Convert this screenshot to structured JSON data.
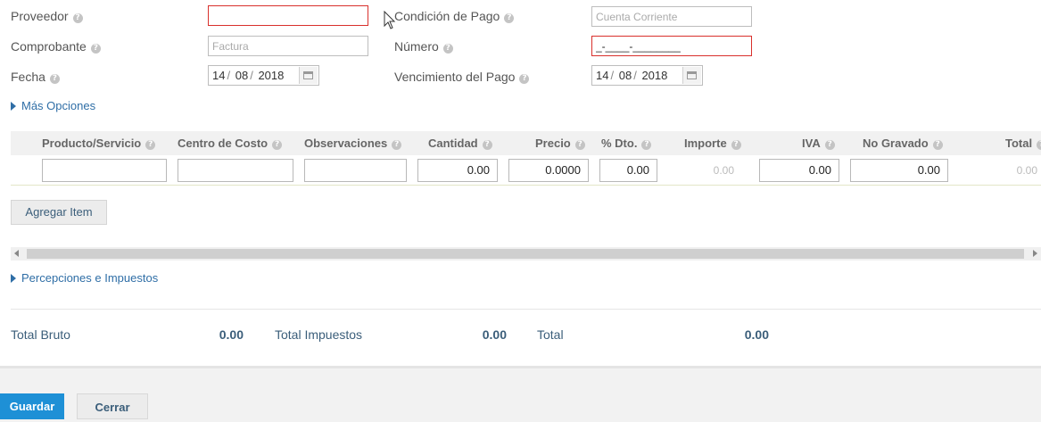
{
  "form": {
    "proveedor": {
      "label": "Proveedor",
      "value": ""
    },
    "condicion_pago": {
      "label": "Condición de Pago",
      "placeholder": "Cuenta Corriente"
    },
    "comprobante": {
      "label": "Comprobante",
      "placeholder": "Factura"
    },
    "numero": {
      "label": "Número",
      "value": "_-____-________"
    },
    "fecha": {
      "label": "Fecha",
      "day": "14",
      "month": "08",
      "year": "2018"
    },
    "vencimiento": {
      "label": "Vencimiento del Pago",
      "day": "14",
      "month": "08",
      "year": "2018"
    },
    "mas_opciones": "Más Opciones"
  },
  "items_table": {
    "columns": {
      "producto": "Producto/Servicio",
      "centro": "Centro de Costo",
      "observaciones": "Observaciones",
      "cantidad": "Cantidad",
      "precio": "Precio",
      "dto": "% Dto.",
      "importe": "Importe",
      "iva": "IVA",
      "no_gravado": "No Gravado",
      "total": "Total"
    },
    "row": {
      "producto": "",
      "centro": "",
      "observaciones": "",
      "cantidad": "0.00",
      "precio": "0.0000",
      "dto": "0.00",
      "importe": "0.00",
      "iva": "0.00",
      "no_gravado": "0.00",
      "total": "0.00"
    },
    "agregar_item": "Agregar Item"
  },
  "percepciones": "Percepciones e Impuestos",
  "totals": {
    "bruto": {
      "label": "Total Bruto",
      "value": "0.00"
    },
    "impuestos": {
      "label": "Total Impuestos",
      "value": "0.00"
    },
    "total": {
      "label": "Total",
      "value": "0.00"
    }
  },
  "footer": {
    "guardar": "Guardar",
    "cerrar": "Cerrar"
  },
  "colors": {
    "accent": "#2f6ea6",
    "primary_button": "#1e90d6",
    "invalid_border": "#d9302c"
  }
}
